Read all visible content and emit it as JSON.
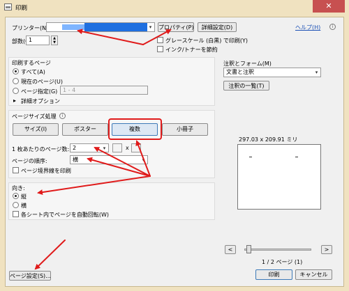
{
  "window": {
    "title": "印刷",
    "close_glyph": "✕"
  },
  "printer": {
    "label": "プリンター(N):",
    "properties_button": "プロパティ(P)",
    "advanced_button": "詳細設定(D)",
    "help_link": "ヘルプ(H)",
    "copies_label": "部数(C):",
    "copies_value": "1",
    "grayscale_label": "グレースケール (白黒) で印刷(Y)",
    "ink_saver_label": "インク/トナーを節約"
  },
  "pages_to_print": {
    "title": "印刷するページ",
    "options": [
      "すべて(A)",
      "現在のページ(U)",
      "ページ指定(G)"
    ],
    "range_placeholder": "1 - 4",
    "more_options": "詳細オプション"
  },
  "comments_forms": {
    "title": "注釈とフォーム(M)",
    "selected": "文書と注釈",
    "summary_button": "注釈の一覧(T)"
  },
  "page_sizing": {
    "title": "ページサイズ処理",
    "info_glyph": "i",
    "tabs": [
      "サイズ(I)",
      "ポスター",
      "複数",
      "小冊子"
    ],
    "pages_per_sheet_label": "1 枚あたりのページ数:",
    "pages_per_sheet_value": "2",
    "by_label": "x",
    "page_order_label": "ページの順序:",
    "page_order_value": "横",
    "print_border_label": "ページ境界線を印刷"
  },
  "orientation": {
    "title": "向き:",
    "options": [
      "縦",
      "横"
    ],
    "auto_rotate_label": "各シート内でページを自動回転(W)"
  },
  "preview": {
    "size_label": "297.03 x 209.91 ミリ",
    "page_counter": "1 / 2 ページ (1)",
    "prev_glyph": "<",
    "next_glyph": ">"
  },
  "footer": {
    "page_setup_button": "ページ設定(S)...",
    "print_button": "印刷",
    "cancel_button": "キャンセル"
  },
  "icons": {
    "dropdown_glyph": "▾",
    "expand_glyph": "▸"
  },
  "colors": {
    "annotation_red": "#e01a1a",
    "title_bg": "#f0e2c0"
  }
}
